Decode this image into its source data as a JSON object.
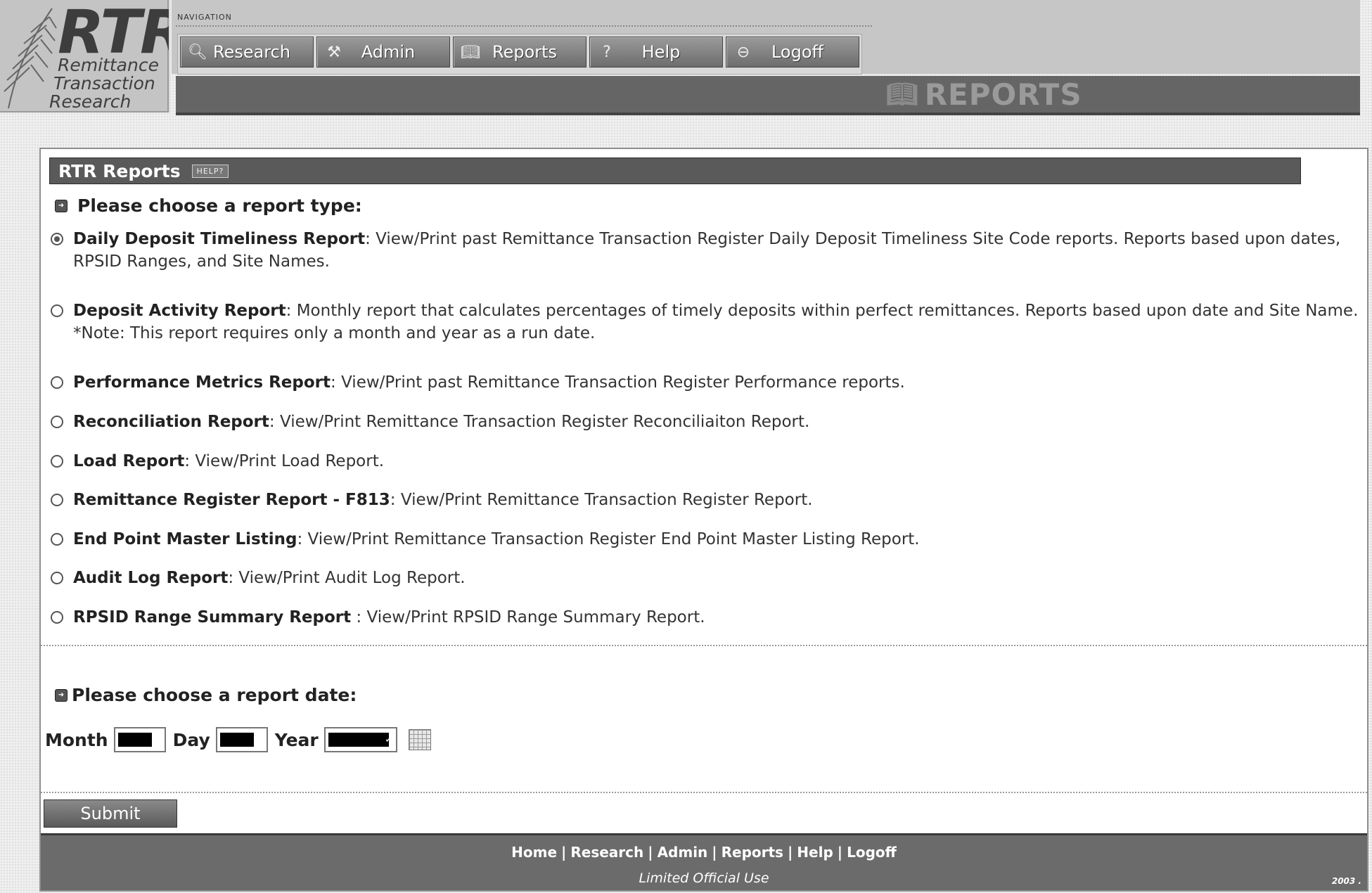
{
  "logo": {
    "title": "RTR",
    "line1": "Remittance",
    "line2": "Transaction",
    "line3": "Research"
  },
  "nav": {
    "label": "NAVIGATION",
    "items": [
      {
        "label": "Research",
        "icon": "magnifier-icon"
      },
      {
        "label": "Admin",
        "icon": "tools-icon"
      },
      {
        "label": "Reports",
        "icon": "book-icon"
      },
      {
        "label": "Help",
        "icon": "question-icon"
      },
      {
        "label": "Logoff",
        "icon": "minus-circle-icon"
      }
    ]
  },
  "banner": {
    "title": "REPORTS",
    "icon": "book-icon"
  },
  "panel": {
    "title": "RTR Reports",
    "help_tag": "HELP?",
    "report_type_heading": "Please choose a report type:",
    "reports": [
      {
        "name": "Daily Deposit Timeliness Report",
        "desc": ": View/Print past Remittance Transaction Register Daily Deposit Timeliness Site Code reports. Reports based upon dates, RPSID Ranges, and Site Names.",
        "checked": true
      },
      {
        "name": "Deposit Activity Report",
        "desc": ": Monthly report that calculates percentages of timely deposits within perfect remittances. Reports based upon date and Site Name. *Note: This report requires only a month and year as a run date.",
        "checked": false
      },
      {
        "name": "Performance Metrics Report",
        "desc": ": View/Print past Remittance Transaction Register Performance reports.",
        "checked": false
      },
      {
        "name": "Reconciliation Report",
        "desc": ": View/Print Remittance Transaction Register Reconciliaiton Report.",
        "checked": false
      },
      {
        "name": "Load Report",
        "desc": ": View/Print Load Report.",
        "checked": false
      },
      {
        "name": "Remittance Register Report - F813",
        "desc": ": View/Print Remittance Transaction Register Report.",
        "checked": false
      },
      {
        "name": "End Point Master Listing",
        "desc": ": View/Print Remittance Transaction Register End Point Master Listing Report.",
        "checked": false
      },
      {
        "name": "Audit Log Report",
        "desc": ": View/Print Audit Log Report.",
        "checked": false
      },
      {
        "name": "RPSID Range Summary Report",
        "desc": " : View/Print RPSID Range Summary Report.",
        "checked": false
      }
    ],
    "report_date_heading": "Please choose a report date:",
    "date": {
      "month_label": "Month",
      "day_label": "Day",
      "year_label": "Year"
    },
    "submit_label": "Submit"
  },
  "footer": {
    "links": [
      "Home",
      "Research",
      "Admin",
      "Reports",
      "Help",
      "Logoff"
    ],
    "note": "Limited Official Use",
    "year": "2003 ."
  }
}
